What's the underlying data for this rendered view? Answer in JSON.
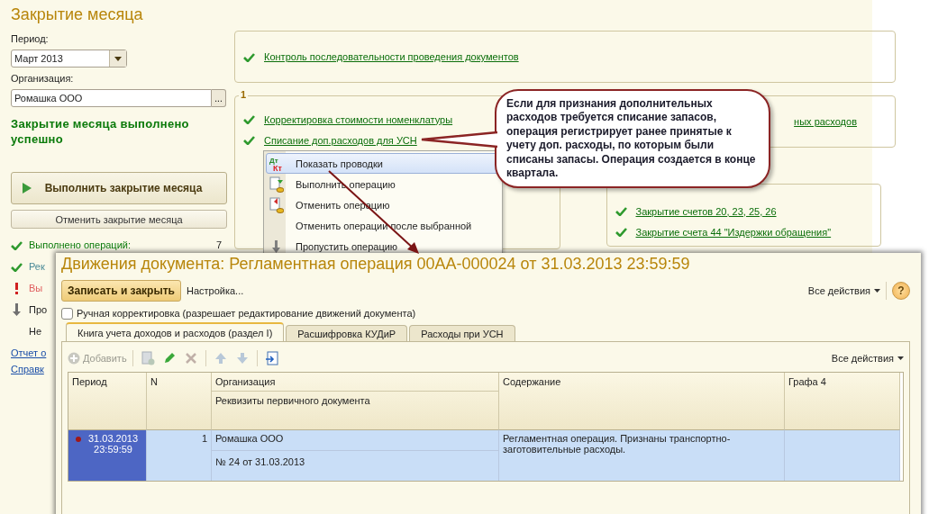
{
  "form": {
    "title": "Закрытие месяца",
    "period_label": "Период:",
    "period": "Март 2013",
    "org_label": "Организация:",
    "org": "Ромашка ООО",
    "org_button": "...",
    "result": "Закрытие месяца выполнено успешно",
    "run_button": "Выполнить закрытие месяца",
    "cancel_button": "Отменить закрытие месяца",
    "stats": [
      {
        "kind": "done",
        "text": "Выполнено операций:",
        "count": "7"
      },
      {
        "kind": "info",
        "text": "Рек"
      },
      {
        "kind": "error",
        "text": "Вы"
      },
      {
        "kind": "skipped",
        "text": "Про"
      },
      {
        "kind": "none",
        "text": "Не"
      }
    ],
    "links": [
      "Отчет о",
      "Справк"
    ]
  },
  "top_group": {
    "items": [
      {
        "text": "Контроль последовательности проведения документов",
        "done": true
      }
    ]
  },
  "groups": [
    {
      "number": "1",
      "items": [
        {
          "text": "Корректировка стоимости номенклатуры",
          "done": true
        },
        {
          "text": "Списание доп.расходов для УСН",
          "done": true
        }
      ]
    },
    {
      "items": [
        {
          "text": "ных расходов",
          "done": false
        }
      ]
    },
    {
      "items": [
        {
          "text": "Закрытие счетов 20, 23, 25, 26",
          "done": true
        },
        {
          "text": "Закрытие счета 44 \"Издержки обращения\"",
          "done": true
        }
      ]
    }
  ],
  "context_menu": {
    "items": [
      {
        "kind": "dtkt",
        "text": "Показать проводки",
        "icon_top": "Дт",
        "icon_bottom": "Кт",
        "selected": true
      },
      {
        "kind": "run",
        "text": "Выполнить операцию",
        "selected": false
      },
      {
        "kind": "undo",
        "text": "Отменить операцию",
        "selected": false
      },
      {
        "kind": "none",
        "text": "Отменить операции после выбранной",
        "selected": false
      },
      {
        "kind": "skip",
        "text": "Пропустить операцию",
        "selected": false
      }
    ]
  },
  "callout": {
    "text": "Если для признания дополнительных расходов  требуется  списание запасов, операция регистрирует ранее принятые к учету доп. расходы, по которым были списаны запасы. Операция создается в конце квартала."
  },
  "document_window": {
    "title": "Движения документа: Регламентная операция 00АА-000024 от 31.03.2013 23:59:59",
    "save_button": "Записать и закрыть",
    "settings_link": "Настройка...",
    "all_actions": "Все действия",
    "help": "?",
    "manual_checkbox": {
      "label": "Ручная корректировка (разрешает редактирование движений документа)",
      "checked": false
    },
    "tabs": [
      {
        "label": "Книга учета доходов и расходов (раздел I)",
        "selected": true
      },
      {
        "label": "Расшифровка КУДиР",
        "selected": false
      },
      {
        "label": "Расходы при УСН",
        "selected": false
      }
    ],
    "add_button": {
      "label": "Добавить",
      "disabled": true
    },
    "table_all_actions": "Все действия",
    "table": {
      "columns": [
        {
          "title": "Период"
        },
        {
          "title": "N"
        },
        {
          "title": "Организация",
          "subtitle": "Реквизиты первичного документа"
        },
        {
          "title": "Содержание"
        },
        {
          "title": "Графа 4"
        }
      ],
      "rows": [
        {
          "selected": true,
          "period": [
            "31.03.2013",
            "23:59:59"
          ],
          "number": "1",
          "organization": "Ромашка ООО",
          "document": "№ 24 от 31.03.2013",
          "content": "Регламентная операция. Признаны транспортно-заготовительные расходы."
        }
      ]
    }
  }
}
